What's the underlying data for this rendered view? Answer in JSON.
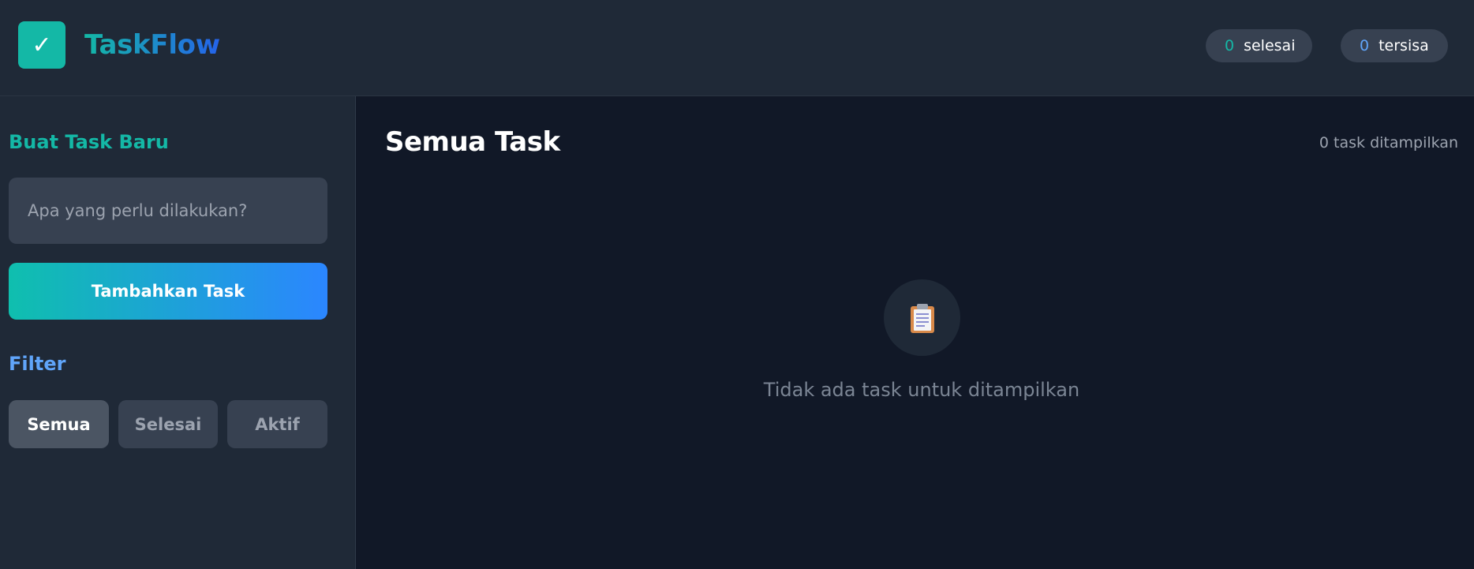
{
  "header": {
    "logo_icon": "checkmark-icon",
    "logo_glyph": "✓",
    "app_title": "TaskFlow",
    "stats": {
      "done_count": "0",
      "done_label": "selesai",
      "remaining_count": "0",
      "remaining_label": "tersisa"
    }
  },
  "sidebar": {
    "create_title": "Buat Task Baru",
    "task_input": {
      "value": "",
      "placeholder": "Apa yang perlu dilakukan?"
    },
    "add_button_label": "Tambahkan Task",
    "filter_title": "Filter",
    "filters": [
      {
        "label": "Semua",
        "active": true
      },
      {
        "label": "Selesai",
        "active": false
      },
      {
        "label": "Aktif",
        "active": false
      }
    ]
  },
  "main": {
    "title": "Semua Task",
    "count_text": "0 task ditampilkan",
    "empty_state": {
      "icon": "clipboard-icon",
      "text": "Tidak ada task untuk ditampilkan"
    }
  },
  "colors": {
    "accent_teal": "#14b8a6",
    "accent_blue": "#2563eb",
    "filter_blue": "#60a5fa",
    "panel_bg": "#1f2937",
    "main_bg": "#111827"
  }
}
